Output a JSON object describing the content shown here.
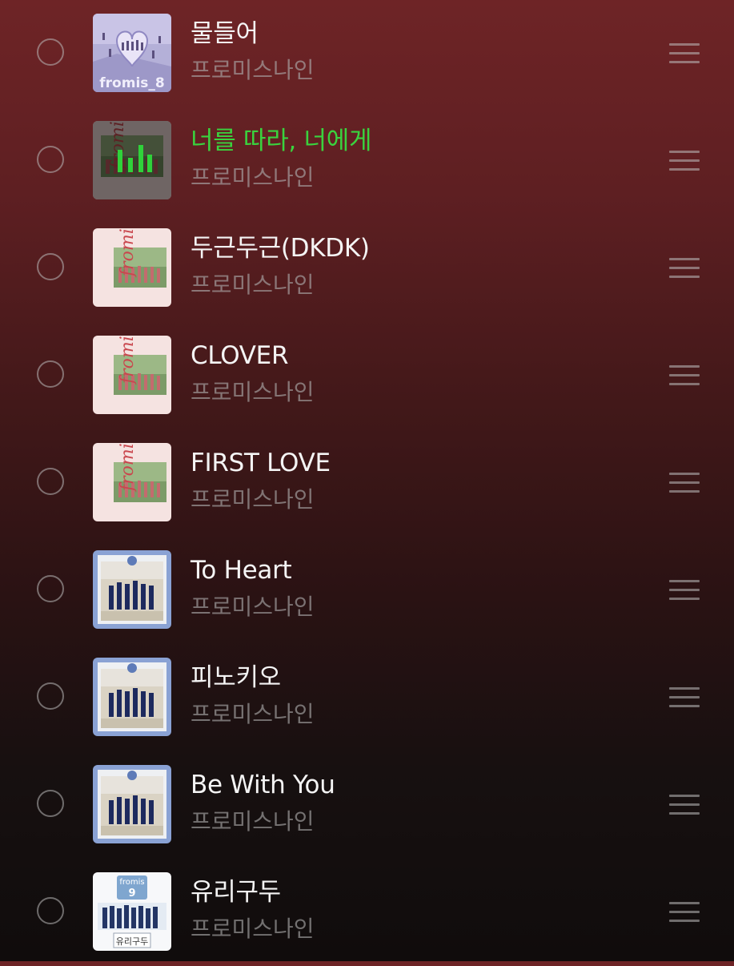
{
  "playlist": {
    "songs": [
      {
        "title": "물들어",
        "artist": "프로미스나인",
        "cover": "fromis-8-cover",
        "playing": false
      },
      {
        "title": "너를 따라, 너에게",
        "artist": "프로미스나인",
        "cover": "fromis-9-to-day-cover",
        "playing": true
      },
      {
        "title": "두근두근(DKDK)",
        "artist": "프로미스나인",
        "cover": "fromis-9-to-day-cover",
        "playing": false
      },
      {
        "title": "CLOVER",
        "artist": "프로미스나인",
        "cover": "fromis-9-to-day-cover",
        "playing": false
      },
      {
        "title": "FIRST LOVE",
        "artist": "프로미스나인",
        "cover": "fromis-9-to-day-cover",
        "playing": false
      },
      {
        "title": "To Heart",
        "artist": "프로미스나인",
        "cover": "to-heart-cover",
        "playing": false
      },
      {
        "title": "피노키오",
        "artist": "프로미스나인",
        "cover": "to-heart-cover",
        "playing": false
      },
      {
        "title": "Be With You",
        "artist": "프로미스나인",
        "cover": "to-heart-cover",
        "playing": false
      },
      {
        "title": "유리구두",
        "artist": "프로미스나인",
        "cover": "glass-shoes-cover",
        "playing": false
      }
    ]
  },
  "covers": {
    "fromis_8_text": "fromis_8",
    "fromis_9_text": "fromis 9",
    "glass_shoes_brand": "fromis",
    "glass_shoes_number": "9",
    "glass_shoes_caption": "유리구두"
  },
  "colors": {
    "playing_title": "#3ad23e",
    "equalizer": "#2fd23a"
  }
}
